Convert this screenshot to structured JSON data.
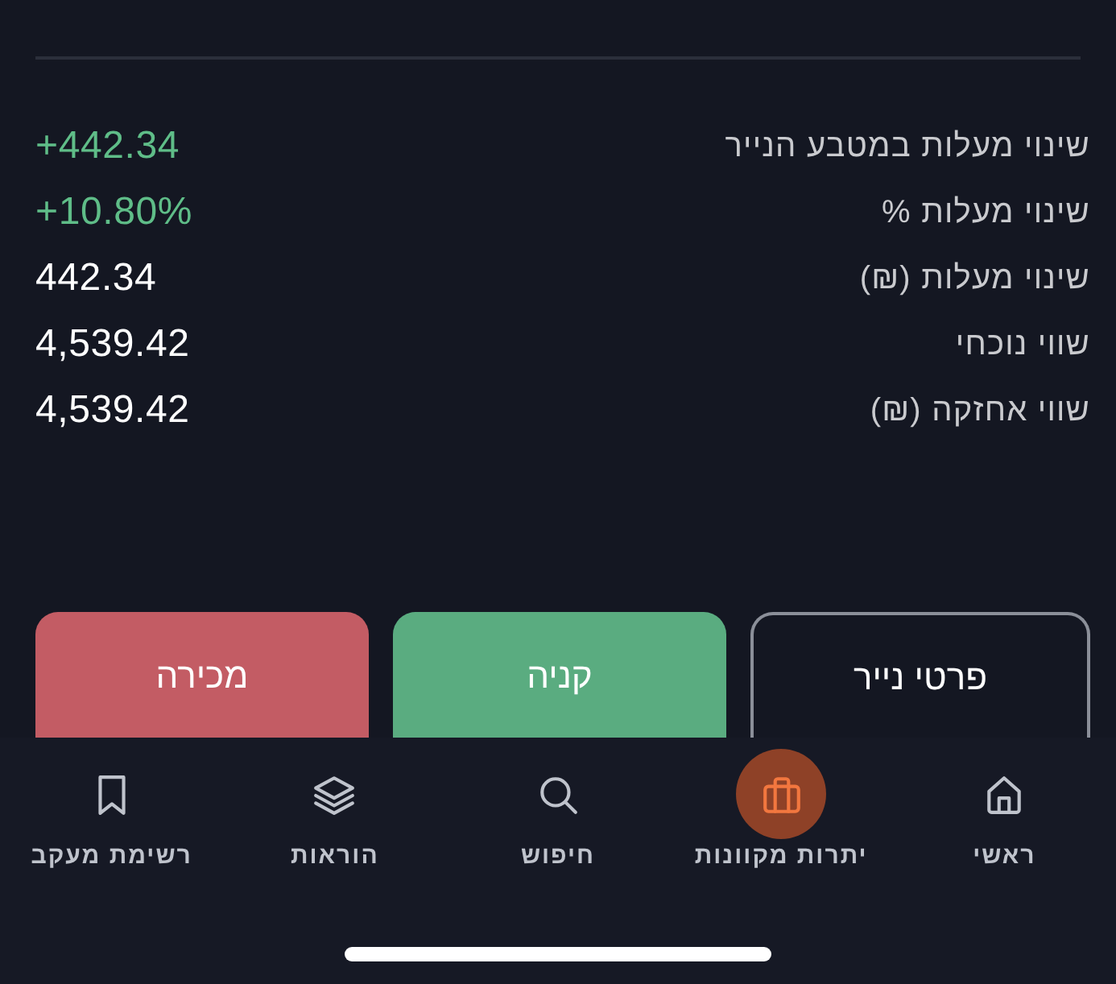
{
  "summary_rows": [
    {
      "label": "שינוי מעלות במטבע הנייר",
      "value": "+442.34",
      "highlighted": true
    },
    {
      "label": "שינוי מעלות %",
      "value": "+10.80%",
      "highlighted": true
    },
    {
      "label": "שינוי מעלות (₪)",
      "value": "442.34",
      "highlighted": false
    },
    {
      "label": "שווי נוכחי",
      "value": "4,539.42",
      "highlighted": false
    },
    {
      "label": "שווי אחזקה (₪)",
      "value": "4,539.42",
      "highlighted": false
    }
  ],
  "actions": [
    {
      "label": "פרטי נייר",
      "kind": "outline"
    },
    {
      "label": "קניה",
      "kind": "buy"
    },
    {
      "label": "מכירה",
      "kind": "sell"
    }
  ],
  "bottom_nav": [
    {
      "label": "ראשי",
      "selected": false
    },
    {
      "label": "יתרות מקוונות",
      "selected": true
    },
    {
      "label": "חיפוש",
      "selected": false
    },
    {
      "label": "הוראות",
      "selected": false
    },
    {
      "label": "רשימת מעקב",
      "selected": false
    }
  ]
}
